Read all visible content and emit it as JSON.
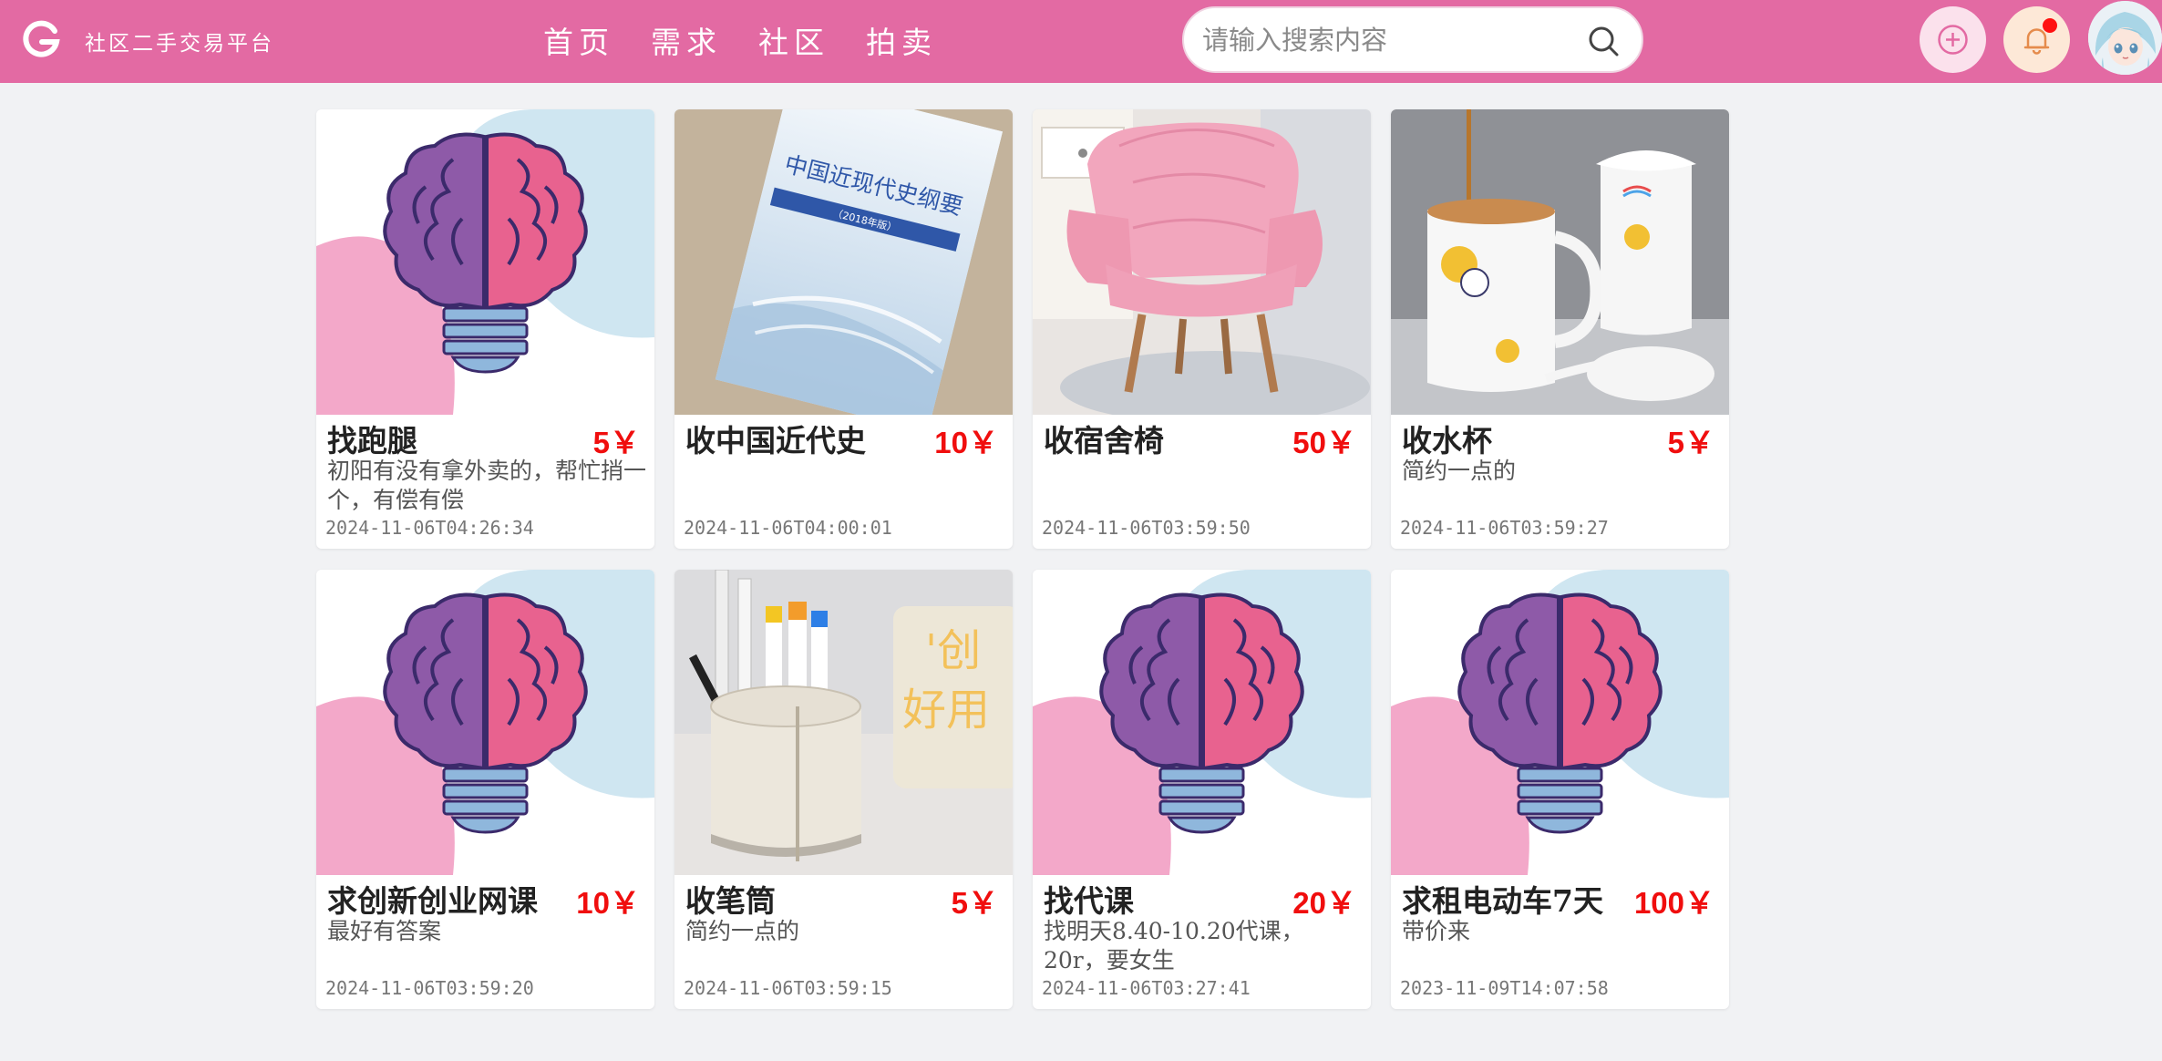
{
  "brand": {
    "name": "社区二手交易平台",
    "accent": "#e36aa3"
  },
  "nav": [
    "首页",
    "需求",
    "社区",
    "拍卖"
  ],
  "search": {
    "placeholder": "请输入搜索内容",
    "value": ""
  },
  "icons": {
    "add": "plus-circle-icon",
    "bell": "bell-icon",
    "search": "search-icon"
  },
  "cards": [
    {
      "title": "找跑腿",
      "price": "5￥",
      "desc": "初阳有没有拿外卖的，帮忙捎一个，有偿有偿",
      "time": "2024-11-06T04:26:34",
      "image": "brain-bulb"
    },
    {
      "title": "收中国近代史",
      "price": "10￥",
      "desc": "",
      "time": "2024-11-06T04:00:01",
      "image": "book"
    },
    {
      "title": "收宿舍椅",
      "price": "50￥",
      "desc": "",
      "time": "2024-11-06T03:59:50",
      "image": "pink-chair"
    },
    {
      "title": "收水杯",
      "price": "5￥",
      "desc": "简约一点的",
      "time": "2024-11-06T03:59:27",
      "image": "mug"
    },
    {
      "title": "求创新创业网课",
      "price": "10￥",
      "desc": "最好有答案",
      "time": "2024-11-06T03:59:20",
      "image": "brain-bulb"
    },
    {
      "title": "收笔筒",
      "price": "5￥",
      "desc": "简约一点的",
      "time": "2024-11-06T03:59:15",
      "image": "pen-holder"
    },
    {
      "title": "找代课",
      "price": "20￥",
      "desc": "找明天8.40-10.20代课，20r，要女生",
      "time": "2024-11-06T03:27:41",
      "image": "brain-bulb"
    },
    {
      "title": "求租电动车7天",
      "price": "100￥",
      "desc": "带价来",
      "time": "2023-11-09T14:07:58",
      "image": "brain-bulb"
    }
  ],
  "book_cover": {
    "title": "中国近现代史纲要",
    "edition": "（2018年版）"
  },
  "pen_holder_sign": [
    "'创",
    "好用"
  ]
}
